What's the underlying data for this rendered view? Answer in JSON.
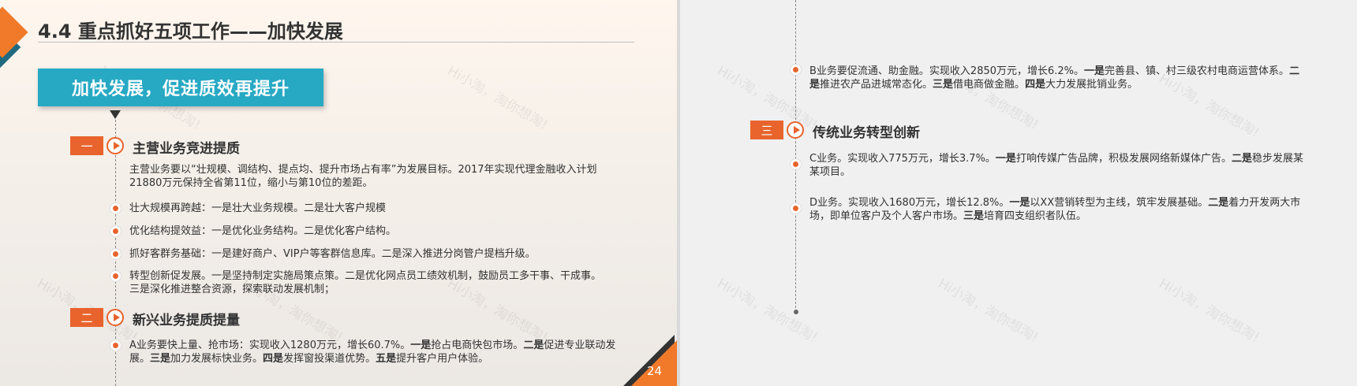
{
  "left_slide": {
    "title": "4.4 重点抓好五项工作——加快发展",
    "banner": "加快发展，促进质效再提升",
    "section1": {
      "num": "一",
      "title": "主营业务竞进提质",
      "intro": "主营业务要以“壮规模、调结构、提点均、提升市场占有率”为发展目标。2017年实现代理金融收入计划21880万元保持全省第11位，缩小与第10位的差距。",
      "items": [
        "壮大规模再跨越：一是壮大业务规模。二是壮大客户规模",
        "优化结构提效益：一是优化业务结构。二是优化客户结构。",
        "抓好客群务基础：一是建好商户、VIP户等客群信息库。二是深入推进分岗管户提档升级。",
        "转型创新促发展。一是坚持制定实施局策点策。二是优化网点员工绩效机制，鼓励员工多干事、干成事。三是深化推进整合资源，探索联动发展机制；"
      ]
    },
    "section2": {
      "num": "二",
      "title": "新兴业务提质提量",
      "item_a": {
        "p1": "A业务要快上量、抢市场：实现收入1280万元，增长60.7%。",
        "k1": "一是",
        "p2": "抢占电商快包市场。",
        "k2": "二是",
        "p3": "促进专业联动发展。",
        "k3": "三是",
        "p4": "加力发展标快业务。",
        "k4": "四是",
        "p5": "发挥窗投渠道优势。",
        "k5": "五是",
        "p6": "提升客户用户体验。"
      }
    },
    "page_number": "24",
    "watermark": "Hi小淘，淘你想淘!"
  },
  "right_slide": {
    "item_b": {
      "p1": "B业务要促流通、助金融。实现收入2850万元，增长6.2%。",
      "k1": "一是",
      "p2": "完善县、镇、村三级农村电商运营体系。",
      "k2": "二是",
      "p3": "推进农产品进城常态化。",
      "k3": "三是",
      "p4": "借电商做金融。",
      "k4": "四是",
      "p5": "大力发展批销业务。"
    },
    "section3": {
      "num": "三",
      "title": "传统业务转型创新"
    },
    "item_c": {
      "p1": "C业务。实现收入775万元，增长3.7%。",
      "k1": "一是",
      "p2": "打响传媒广告品牌，积极发展网络新媒体广告。",
      "k2": "二是",
      "p3": "稳步发展某某项目。"
    },
    "item_d": {
      "p1": "D业务。实现收入1680万元，增长12.8%。",
      "k1": "一是",
      "p2": "以XX营销转型为主线，筑牢发展基础。",
      "k2": "二是",
      "p3": "着力开发两大市场，即单位客户及个人客户市场。",
      "k3": "三是",
      "p4": "培育四支组织者队伍。"
    },
    "watermark": "Hi小淘，淘你想淘!"
  },
  "colors": {
    "accent_orange": "#e8642c",
    "banner_teal": "#27a9c4",
    "corner_blue": "#1f6a7e",
    "text": "#333333"
  }
}
